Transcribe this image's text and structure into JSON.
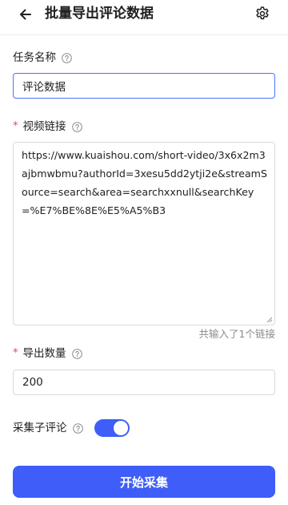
{
  "header": {
    "title": "批量导出评论数据",
    "back_icon": "arrow-left-icon",
    "settings_icon": "gear-icon"
  },
  "task_name": {
    "label": "任务名称",
    "value": "评论数据"
  },
  "video_links": {
    "required_mark": "*",
    "label": "视频链接",
    "value": "https://www.kuaishou.com/short-video/3x6x2m3ajbmwbmu?authorId=3xesu5dd2ytji2e&streamSource=search&area=searchxxnull&searchKey=%E7%BE%8E%E5%A5%B3",
    "count_hint": "共输入了1个链接"
  },
  "export_count": {
    "required_mark": "*",
    "label": "导出数量",
    "value": "200"
  },
  "sub_comments": {
    "label": "采集子评论",
    "enabled": true
  },
  "submit": {
    "label": "开始采集"
  },
  "colors": {
    "accent": "#3f5df8",
    "focus_border": "#4a72ff",
    "required": "#e5484d"
  }
}
